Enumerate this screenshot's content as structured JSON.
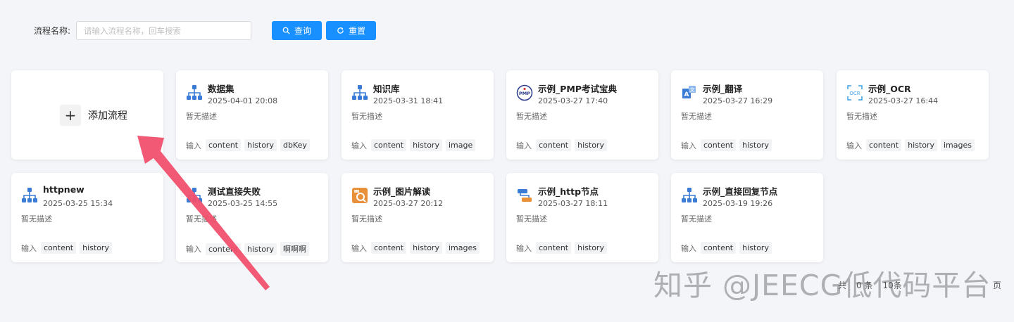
{
  "search": {
    "label": "流程名称:",
    "placeholder": "请输入流程名称，回车搜索",
    "query_label": "查询",
    "reset_label": "重置"
  },
  "add_card": {
    "label": "添加流程",
    "plus": "+"
  },
  "cards": [
    {
      "title": "数据集",
      "time": "2025-04-01 20:08",
      "desc": "暂无描述",
      "inputs_label": "输入",
      "tags": [
        "content",
        "history",
        "dbKey"
      ],
      "icon": "org-tree-icon"
    },
    {
      "title": "知识库",
      "time": "2025-03-31 18:41",
      "desc": "暂无描述",
      "inputs_label": "输入",
      "tags": [
        "content",
        "history",
        "image"
      ],
      "icon": "org-tree-icon"
    },
    {
      "title": "示例_PMP考试宝典",
      "time": "2025-03-27 17:40",
      "desc": "暂无描述",
      "inputs_label": "输入",
      "tags": [
        "content",
        "history"
      ],
      "icon": "pmp-icon"
    },
    {
      "title": "示例_翻译",
      "time": "2025-03-27 16:29",
      "desc": "暂无描述",
      "inputs_label": "输入",
      "tags": [
        "content",
        "history"
      ],
      "icon": "translate-icon"
    },
    {
      "title": "示例_OCR",
      "time": "2025-03-27 16:44",
      "desc": "暂无描述",
      "inputs_label": "输入",
      "tags": [
        "content",
        "history",
        "images"
      ],
      "icon": "ocr-icon"
    },
    {
      "title": "httpnew",
      "time": "2025-03-25 15:34",
      "desc": "暂无描述",
      "inputs_label": "输入",
      "tags": [
        "content",
        "history"
      ],
      "icon": "org-tree-icon"
    },
    {
      "title": "测试直接失败",
      "time": "2025-03-25 14:55",
      "desc": "暂无描述",
      "inputs_label": "输入",
      "tags": [
        "content",
        "history",
        "啊啊啊"
      ],
      "icon": "org-tree-icon"
    },
    {
      "title": "示例_图片解读",
      "time": "2025-03-27 20:12",
      "desc": "暂无描述",
      "inputs_label": "输入",
      "tags": [
        "content",
        "history",
        "images"
      ],
      "icon": "image-read-icon"
    },
    {
      "title": "示例_http节点",
      "time": "2025-03-27 18:11",
      "desc": "暂无描述",
      "inputs_label": "输入",
      "tags": [
        "content",
        "history"
      ],
      "icon": "http-node-icon"
    },
    {
      "title": "示例_直接回复节点",
      "time": "2025-03-19 19:26",
      "desc": "暂无描述",
      "inputs_label": "输入",
      "tags": [
        "content",
        "history"
      ],
      "icon": "org-tree-icon"
    }
  ],
  "watermark": "知乎 @JEECG低代码平台",
  "pagination": {
    "total": "共",
    "page": "0 条",
    "size": "10条",
    "unit": "页"
  },
  "colors": {
    "primary": "#1890ff",
    "arrow": "#f0506e",
    "icon_blue": "#3a7bd5",
    "image_icon": "#e8903a"
  }
}
